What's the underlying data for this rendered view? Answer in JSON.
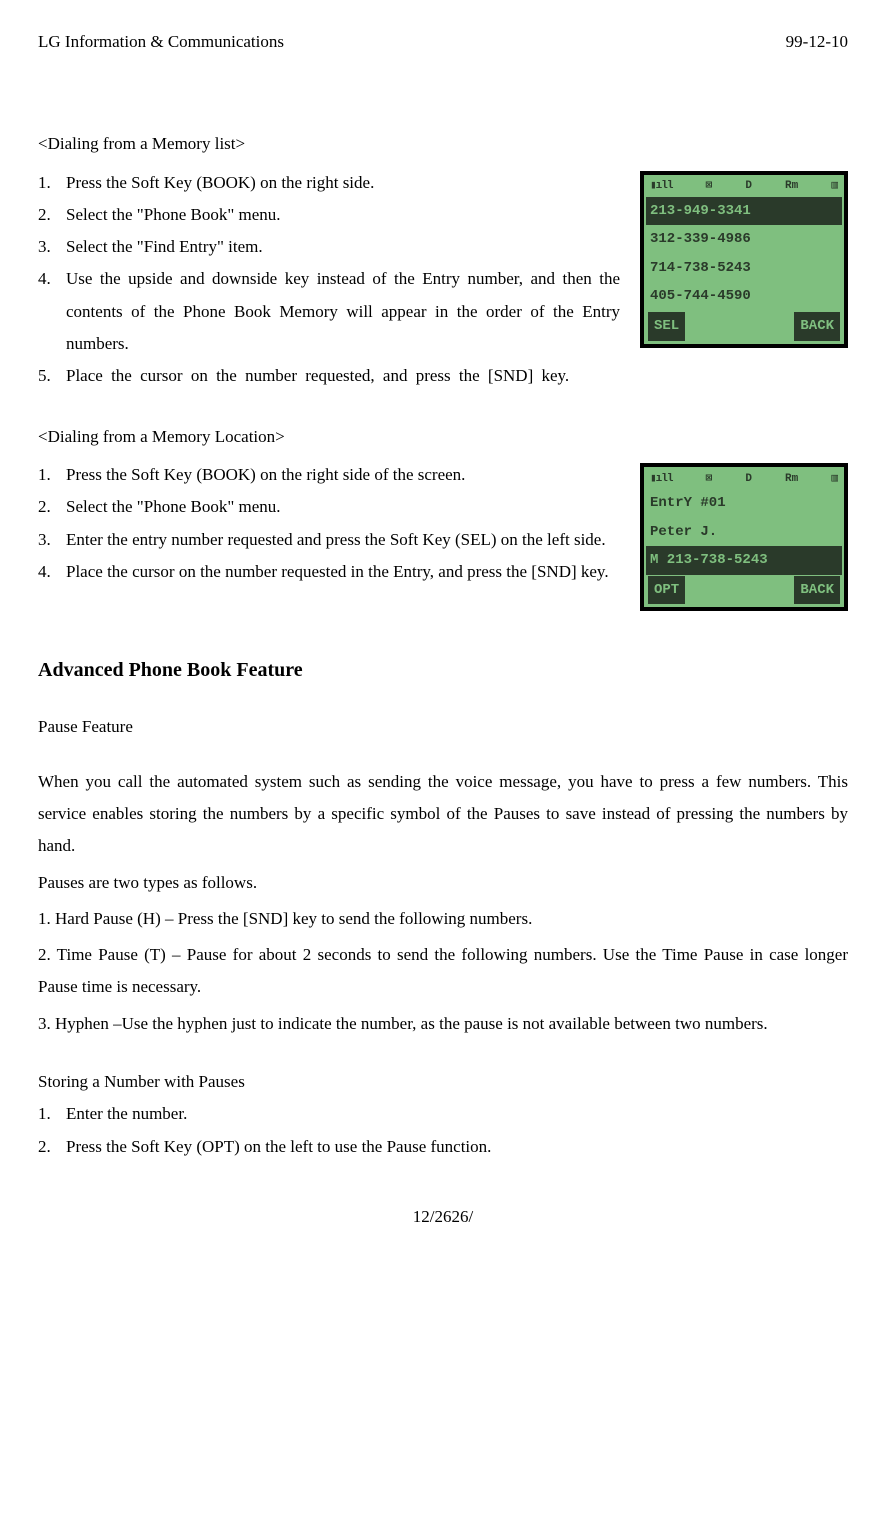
{
  "header": {
    "left": "LG Information & Communications",
    "right": "99-12-10"
  },
  "footer": "12/2626/",
  "sectionA": {
    "title": "<Dialing from a Memory list>",
    "items": [
      "Press the Soft Key (BOOK) on the right side.",
      "Select the \"Phone Book\" menu.",
      "Select the \"Find Entry\" item.",
      "Use the upside and downside key instead of the Entry number, and then the contents of the Phone Book Memory will appear in the order of the Entry numbers.",
      "Place the cursor on the number requested, and press the [SND] key."
    ],
    "screen": {
      "lines": [
        "213-949-3341",
        "312-339-4986",
        "714-738-5243",
        "405-744-4590"
      ],
      "softLeft": "SEL",
      "softRight": "BACK"
    }
  },
  "sectionB": {
    "title": "<Dialing from a Memory Location>",
    "items": [
      "Press the Soft Key (BOOK) on the right side of the screen.",
      "Select the \"Phone Book\" menu.",
      "Enter the entry number requested and press the Soft Key (SEL) on the left side.",
      "Place the cursor on the number requested in the Entry, and press the [SND] key."
    ],
    "screen": {
      "lines": [
        "EntrY #01",
        "Peter J.",
        "M 213-738-5243"
      ],
      "softLeft": "OPT",
      "softRight": "BACK"
    }
  },
  "advanced": {
    "heading": "Advanced Phone Book Feature",
    "subheading": "Pause Feature",
    "para1": "When you call the automated system such as sending the voice message, you have to press a few numbers. This service enables storing the numbers by a specific symbol of the Pauses to save instead of pressing the numbers by hand.",
    "para2": "Pauses are two types as follows.",
    "items": [
      "1. Hard Pause (H) – Press the [SND] key to send the following numbers.",
      "2. Time Pause (T) – Pause for about 2 seconds to send the following numbers. Use the Time Pause in case longer Pause time is necessary.",
      "3.   Hyphen –Use the hyphen just to indicate the number, as the pause is not available between two numbers."
    ]
  },
  "storing": {
    "title": "Storing a Number with Pauses",
    "items": [
      "Enter the number.",
      "Press the Soft Key (OPT) on the left to use the Pause function."
    ]
  },
  "icons": {
    "signal": "▮ıll",
    "msg": "⊠",
    "d": "D",
    "rm": "Rm",
    "batt": "▥"
  }
}
